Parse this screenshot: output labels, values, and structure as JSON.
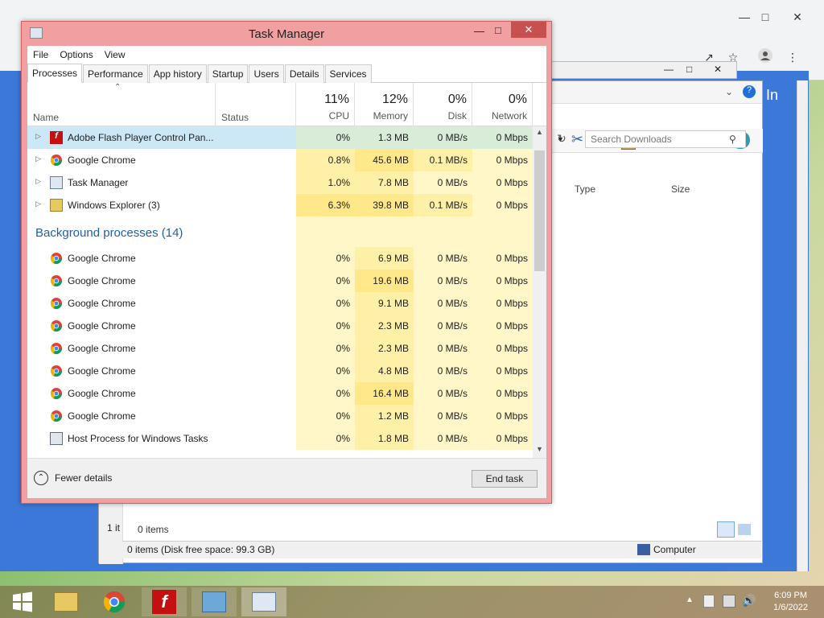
{
  "window": {
    "title": "Task Manager"
  },
  "menu": [
    "File",
    "Options",
    "View"
  ],
  "tabs": [
    "Processes",
    "Performance",
    "App history",
    "Startup",
    "Users",
    "Details",
    "Services"
  ],
  "columns": {
    "name": "Name",
    "status": "Status",
    "cpu": {
      "pct": "11%",
      "label": "CPU"
    },
    "memory": {
      "pct": "12%",
      "label": "Memory"
    },
    "disk": {
      "pct": "0%",
      "label": "Disk"
    },
    "network": {
      "pct": "0%",
      "label": "Network"
    }
  },
  "apps": [
    {
      "name": "Adobe Flash Player Control Pan...",
      "cpu": "0%",
      "mem": "1.3 MB",
      "disk": "0 MB/s",
      "net": "0 Mbps",
      "icon": "flash-icon"
    },
    {
      "name": "Google Chrome",
      "cpu": "0.8%",
      "mem": "45.6 MB",
      "disk": "0.1 MB/s",
      "net": "0 Mbps",
      "icon": "chrome-icon"
    },
    {
      "name": "Task Manager",
      "cpu": "1.0%",
      "mem": "7.8 MB",
      "disk": "0 MB/s",
      "net": "0 Mbps",
      "icon": "task-manager-icon"
    },
    {
      "name": "Windows Explorer (3)",
      "cpu": "6.3%",
      "mem": "39.8 MB",
      "disk": "0.1 MB/s",
      "net": "0 Mbps",
      "icon": "folder-icon"
    }
  ],
  "background_header": "Background processes (14)",
  "background": [
    {
      "name": "Google Chrome",
      "cpu": "0%",
      "mem": "6.9 MB",
      "disk": "0 MB/s",
      "net": "0 Mbps"
    },
    {
      "name": "Google Chrome",
      "cpu": "0%",
      "mem": "19.6 MB",
      "disk": "0 MB/s",
      "net": "0 Mbps"
    },
    {
      "name": "Google Chrome",
      "cpu": "0%",
      "mem": "9.1 MB",
      "disk": "0 MB/s",
      "net": "0 Mbps"
    },
    {
      "name": "Google Chrome",
      "cpu": "0%",
      "mem": "2.3 MB",
      "disk": "0 MB/s",
      "net": "0 Mbps"
    },
    {
      "name": "Google Chrome",
      "cpu": "0%",
      "mem": "2.3 MB",
      "disk": "0 MB/s",
      "net": "0 Mbps"
    },
    {
      "name": "Google Chrome",
      "cpu": "0%",
      "mem": "4.8 MB",
      "disk": "0 MB/s",
      "net": "0 Mbps"
    },
    {
      "name": "Google Chrome",
      "cpu": "0%",
      "mem": "16.4 MB",
      "disk": "0 MB/s",
      "net": "0 Mbps"
    },
    {
      "name": "Google Chrome",
      "cpu": "0%",
      "mem": "1.2 MB",
      "disk": "0 MB/s",
      "net": "0 Mbps"
    },
    {
      "name": "Host Process for Windows Tasks",
      "cpu": "0%",
      "mem": "1.8 MB",
      "disk": "0 MB/s",
      "net": "0 Mbps"
    }
  ],
  "footer": {
    "fewer_details": "Fewer details",
    "end_task": "End task"
  },
  "explorer": {
    "search_placeholder": "Search Downloads",
    "col_type": "Type",
    "col_size": "Size",
    "items_count": "0 items",
    "status": "0 items (Disk free space: 99.3 GB)",
    "computer": "Computer",
    "left_status": "1 it",
    "in_label": "In"
  },
  "clock": {
    "time": "6:09 PM",
    "date": "1/6/2022"
  }
}
